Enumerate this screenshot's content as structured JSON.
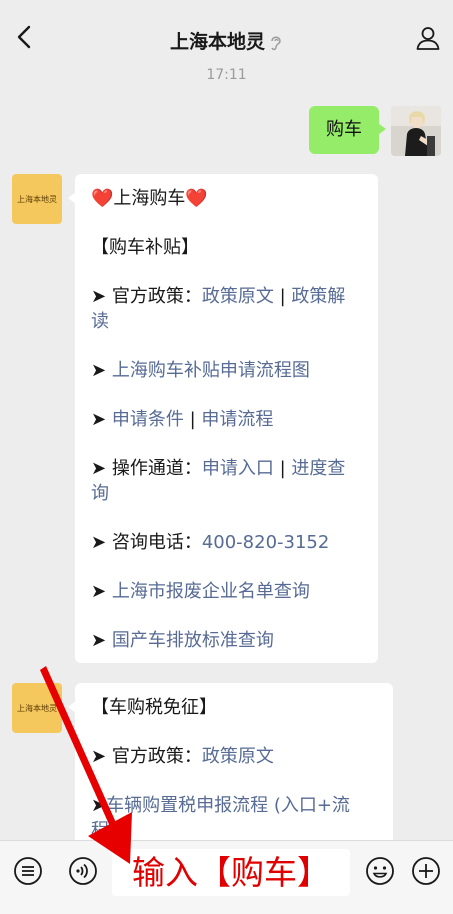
{
  "header": {
    "back_icon": "chevron-left-icon",
    "title": "上海本地灵",
    "title_icon": "ear-icon",
    "profile_icon": "person-icon"
  },
  "chat": {
    "time": "17:11",
    "user_message": "购车",
    "bot_avatar_label": "上海本地灵",
    "card1": {
      "heart_left": "❤️",
      "title": "上海购车",
      "heart_right": "❤️",
      "section": "【购车补贴】",
      "arrow": "➤",
      "policy_label": "官方政策：",
      "policy_link1": "政策原文",
      "separator": "|",
      "policy_link2_a": "政策解",
      "policy_link2_b": "读",
      "flowchart_link": "上海购车补贴申请流程图",
      "conditions_link": "申请条件",
      "process_link": "申请流程",
      "channel_label": "操作通道：",
      "entry_link": "申请入口",
      "progress_link_a": "进度查",
      "progress_link_b": "询",
      "phone_label": "咨询电话：",
      "phone": "400-820-3152",
      "scrap_link": "上海市报废企业名单查询",
      "emission_link": "国产车排放标准查询"
    },
    "card2": {
      "section": "【车购税免征】",
      "policy_label": "官方政策：",
      "policy_link": "政策原文",
      "tax_link_a": "车辆购置税申报流程 (入口+流",
      "tax_link_b": "程"
    }
  },
  "bottombar": {
    "list_icon": "list-icon",
    "voice_icon": "voice-icon",
    "input_value": "输入【购车】",
    "emoji_icon": "emoji-icon",
    "plus_icon": "plus-icon"
  },
  "colors": {
    "user_bubble": "#95ec69",
    "link": "#576b95",
    "annotation": "#e00000"
  }
}
